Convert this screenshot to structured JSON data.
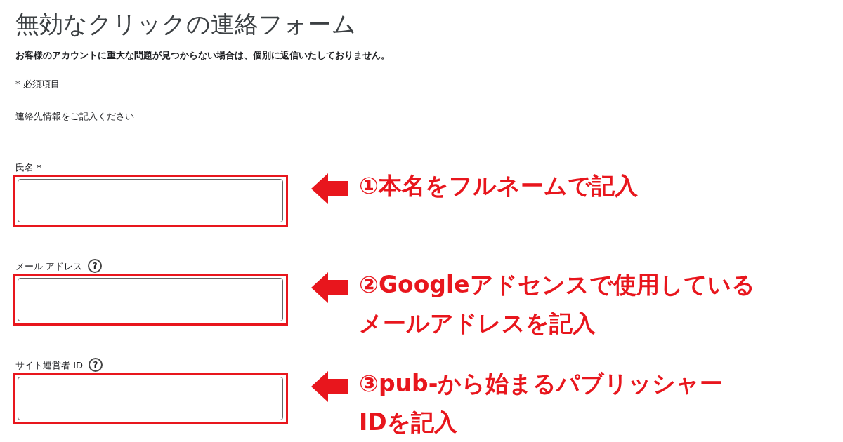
{
  "title": "無効なクリックの連絡フォーム",
  "notice": "お客様のアカウントに重大な問題が見つからない場合は、個別に返信いたしておりません。",
  "required_note": "* 必須項目",
  "section_heading": "連絡先情報をご記入ください",
  "fields": [
    {
      "label": "氏名 *",
      "annotation": [
        "①本名をフルネームで記入"
      ]
    },
    {
      "label": "メール アドレス",
      "help": "?",
      "annotation": [
        "②Googleアドセンスで使用している",
        "メールアドレスを記入"
      ]
    },
    {
      "label": "サイト運営者 ID",
      "help": "?",
      "annotation": [
        "③pub-から始まるパブリッシャー",
        "IDを記入"
      ]
    }
  ]
}
